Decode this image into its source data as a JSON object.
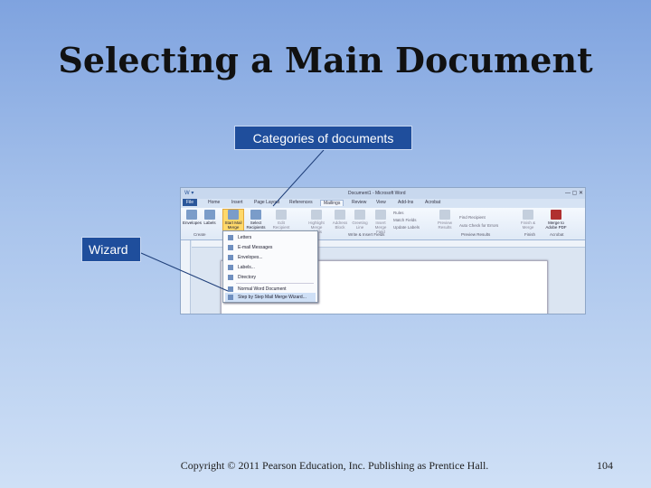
{
  "slide": {
    "title": "Selecting a Main Document",
    "callout_top": "Categories of documents",
    "callout_left": "Wizard",
    "footer": "Copyright © 2011 Pearson Education, Inc. Publishing as Prentice Hall.",
    "page_number": "104"
  },
  "word": {
    "window_title": "Document1 - Microsoft Word",
    "tabs": [
      "File",
      "Home",
      "Insert",
      "Page Layout",
      "References",
      "Mailings",
      "Review",
      "View",
      "Add-Ins",
      "Acrobat"
    ],
    "active_tab": "Mailings",
    "ribbon": {
      "envelopes": "Envelopes",
      "labels": "Labels",
      "start_mail_merge": "Start Mail Merge",
      "select_recipients": "Select Recipients",
      "edit_recipient_list": "Edit Recipient List",
      "highlight_merge_fields": "Highlight Merge Fields",
      "address_block": "Address Block",
      "greeting_line": "Greeting Line",
      "insert_merge_field": "Insert Merge Field",
      "rules": "Rules",
      "match_fields": "Match Fields",
      "update_labels": "Update Labels",
      "preview_results": "Preview Results",
      "find_recipient": "Find Recipient",
      "auto_check_for_errors": "Auto Check for Errors",
      "finish_merge": "Finish & Merge",
      "merge_to_adobe_pdf": "Merge to Adobe PDF",
      "groups": {
        "create": "Create",
        "write_insert": "Write & Insert Fields",
        "preview": "Preview Results",
        "finish": "Finish",
        "acrobat": "Acrobat"
      }
    },
    "menu": [
      "Letters",
      "E-mail Messages",
      "Envelopes...",
      "Labels...",
      "Directory",
      "Normal Word Document",
      "Step by Step Mail Merge Wizard..."
    ]
  },
  "icons": {
    "word_logo": "word-icon",
    "window_controls": "window-controls-icon"
  },
  "colors": {
    "callout_bg": "#1f4e9c",
    "accent": "#2b579a",
    "highlight": "#ffd96b"
  }
}
